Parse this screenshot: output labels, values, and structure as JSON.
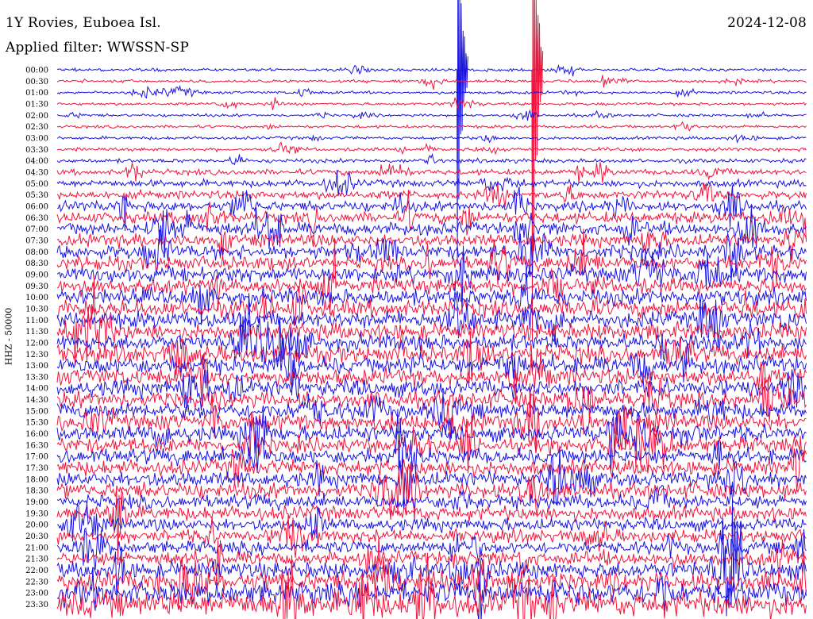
{
  "header": {
    "station": "1Y Rovies, Euboea Isl.",
    "date": "2024-12-08",
    "filter": "Applied filter: WWSSN-SP"
  },
  "channel_label": "HHZ - 50000",
  "colors": {
    "trace_even": "#1a14e0",
    "trace_odd": "#f0143c",
    "background": "#ffffff",
    "text": "#000000"
  },
  "chart_data": {
    "type": "line",
    "variant": "helicorder",
    "rows": [
      "00:00",
      "00:30",
      "01:00",
      "01:30",
      "02:00",
      "02:30",
      "03:00",
      "03:30",
      "04:00",
      "04:30",
      "05:00",
      "05:30",
      "06:00",
      "06:30",
      "07:00",
      "07:30",
      "08:00",
      "08:30",
      "09:00",
      "09:30",
      "10:00",
      "10:30",
      "11:00",
      "11:30",
      "12:00",
      "12:30",
      "13:00",
      "13:30",
      "14:00",
      "14:30",
      "15:00",
      "15:30",
      "16:00",
      "16:30",
      "17:00",
      "17:30",
      "18:00",
      "18:30",
      "19:00",
      "19:30",
      "20:00",
      "20:30",
      "21:00",
      "21:30",
      "22:00",
      "22:30",
      "23:00",
      "23:30"
    ],
    "row_minutes": 30,
    "relative_noise_amplitude": [
      1,
      1,
      1,
      1,
      1,
      1,
      1.1,
      1.2,
      1.5,
      2,
      2.5,
      3,
      3.5,
      4,
      4.5,
      4.5,
      5,
      5,
      5.5,
      5.5,
      6,
      6,
      6,
      6,
      6,
      6,
      6,
      6,
      6,
      6,
      6,
      6,
      5.5,
      5.5,
      5.5,
      5.5,
      5.5,
      5.5,
      5,
      5,
      4.5,
      4.5,
      4.5,
      5,
      6,
      7,
      8,
      9
    ],
    "events": [
      {
        "row": "00:00",
        "minute": 16,
        "relative_amplitude": 30
      },
      {
        "row": "00:00",
        "minute": 19,
        "relative_amplitude": 42
      }
    ]
  }
}
